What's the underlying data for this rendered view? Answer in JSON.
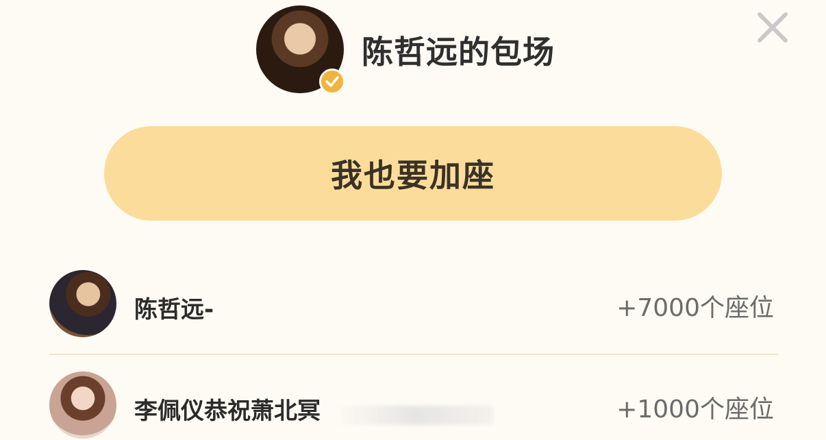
{
  "header": {
    "title": "陈哲远的包场",
    "avatar_icon": "user-avatar",
    "verified_icon": "verified-check-icon",
    "close_icon": "close-icon"
  },
  "join_button": {
    "label": "我也要加座"
  },
  "supporters": [
    {
      "name": "陈哲远-",
      "seats": "+7000个座位"
    },
    {
      "name": "李佩仪恭祝萧北冥",
      "seats": "+1000个座位"
    }
  ],
  "colors": {
    "background": "#fdfbf3",
    "button": "#fbdc9a",
    "badge": "#f2b441",
    "divider": "#f4e5c4"
  }
}
